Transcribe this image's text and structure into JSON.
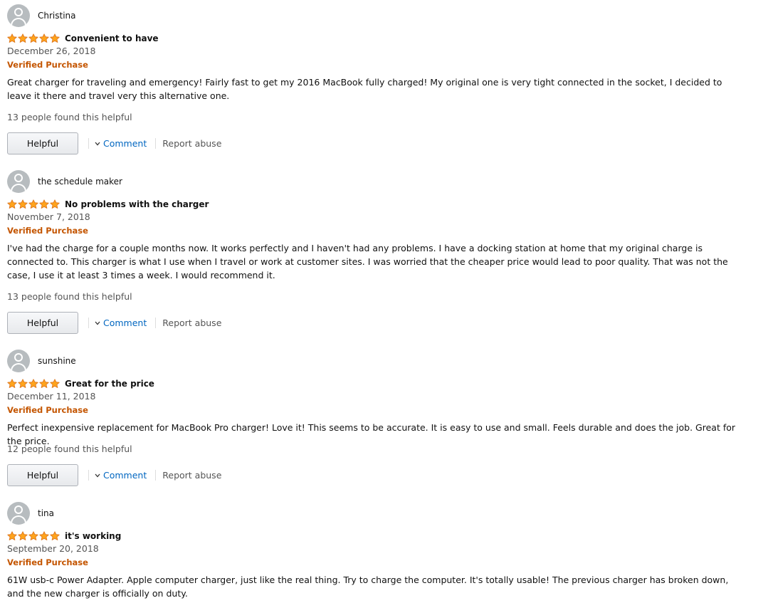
{
  "reviews": [
    {
      "profile_name": "Christina",
      "rating": 5,
      "title": "Convenient to have",
      "date": "December 26, 2018",
      "verified_label": "Verified Purchase",
      "body": "Great charger for traveling and emergency! Fairly fast to get my 2016 MacBook fully charged! My original one is very tight connected in the socket, I decided to leave it there and travel very this alternative one.",
      "helpful_count": "13 people found this helpful",
      "helpful_label": "Helpful",
      "comment_label": "Comment",
      "report_label": "Report abuse"
    },
    {
      "profile_name": "the schedule maker",
      "rating": 5,
      "title": "No problems with the charger",
      "date": "November 7, 2018",
      "verified_label": "Verified Purchase",
      "body": "I've had the charge for a couple months now. It works perfectly and I haven't had any problems. I have a docking station at home that my original charge is connected to. This charger is what I use when I travel or work at customer sites. I was worried that the cheaper price would lead to poor quality. That was not the case, I use it at least 3 times a week. I would recommend it.",
      "helpful_count": "13 people found this helpful",
      "helpful_label": "Helpful",
      "comment_label": "Comment",
      "report_label": "Report abuse"
    },
    {
      "profile_name": "sunshine",
      "rating": 5,
      "title": "Great for the price",
      "date": "December 11, 2018",
      "verified_label": "Verified Purchase",
      "body": "Perfect inexpensive replacement for MacBook Pro charger! Love it! This seems to be accurate. It is easy to use and small. Feels durable and does the job. Great for the price.",
      "helpful_count": "12 people found this helpful",
      "helpful_label": "Helpful",
      "comment_label": "Comment",
      "report_label": "Report abuse"
    },
    {
      "profile_name": "tina",
      "rating": 5,
      "title": "it's working",
      "date": "September 20, 2018",
      "verified_label": "Verified Purchase",
      "body": "61W usb-c Power Adapter. Apple computer charger, just like the real thing. Try to charge the computer. It's totally usable! The previous charger has broken down, and the new charger is officially on duty."
    }
  ],
  "colors": {
    "star_fill": "#ffa41c",
    "star_stroke": "#de7921",
    "verified": "#c45500",
    "link": "#0066c0",
    "muted_text": "#555555",
    "avatar": "#b7bcbf"
  },
  "icons": {
    "avatar": "default-avatar-icon",
    "star": "star-icon",
    "comment_toggle": "chevron-down-icon"
  }
}
